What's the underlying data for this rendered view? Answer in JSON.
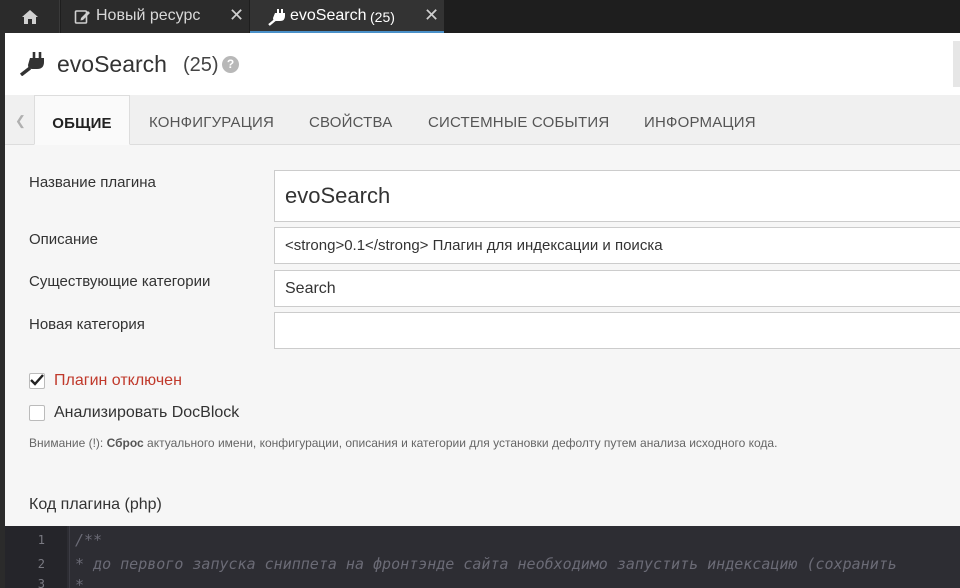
{
  "top_tabs": [
    {
      "label": "Новый ресурс",
      "icon": "edit-icon"
    },
    {
      "label": "evoSearch",
      "count": "(25)",
      "icon": "plug-icon"
    }
  ],
  "close_glyph": "✕",
  "header": {
    "title": "evoSearch",
    "count": "(25)",
    "help": "?"
  },
  "section_tabs": [
    {
      "label": "ОБЩИЕ",
      "active": true
    },
    {
      "label": "КОНФИГУРАЦИЯ"
    },
    {
      "label": "СВОЙСТВА"
    },
    {
      "label": "СИСТЕМНЫЕ СОБЫТИЯ"
    },
    {
      "label": "ИНФОРМАЦИЯ"
    }
  ],
  "form": {
    "name_label": "Название плагина",
    "name_value": "evoSearch",
    "description_label": "Описание",
    "description_value": "<strong>0.1</strong> Плагин для индексации и поиска",
    "existing_category_label": "Существующие категории",
    "existing_category_value": "Search",
    "new_category_label": "Новая категория",
    "new_category_value": "",
    "disabled_label": "Плагин отключен",
    "disabled_checked": true,
    "docblock_label": "Анализировать DocBlock",
    "docblock_checked": false,
    "note_prefix": "Внимание (!): ",
    "note_bold": "Сброс",
    "note_rest": " актуального имени, конфигурации, описания и категории для установки дефолту путем анализа исходного кода."
  },
  "code": {
    "label": "Код плагина (php)",
    "line_numbers": [
      "1",
      "2",
      "3"
    ],
    "lines": [
      "/**",
      " * до первого запуска сниппета на фронтэнде сайта необходимо запустить индексацию (сохранить",
      " *"
    ]
  },
  "colors": {
    "disabled_label": "#c0392b",
    "active_tab_underline": "#4a90c8"
  }
}
